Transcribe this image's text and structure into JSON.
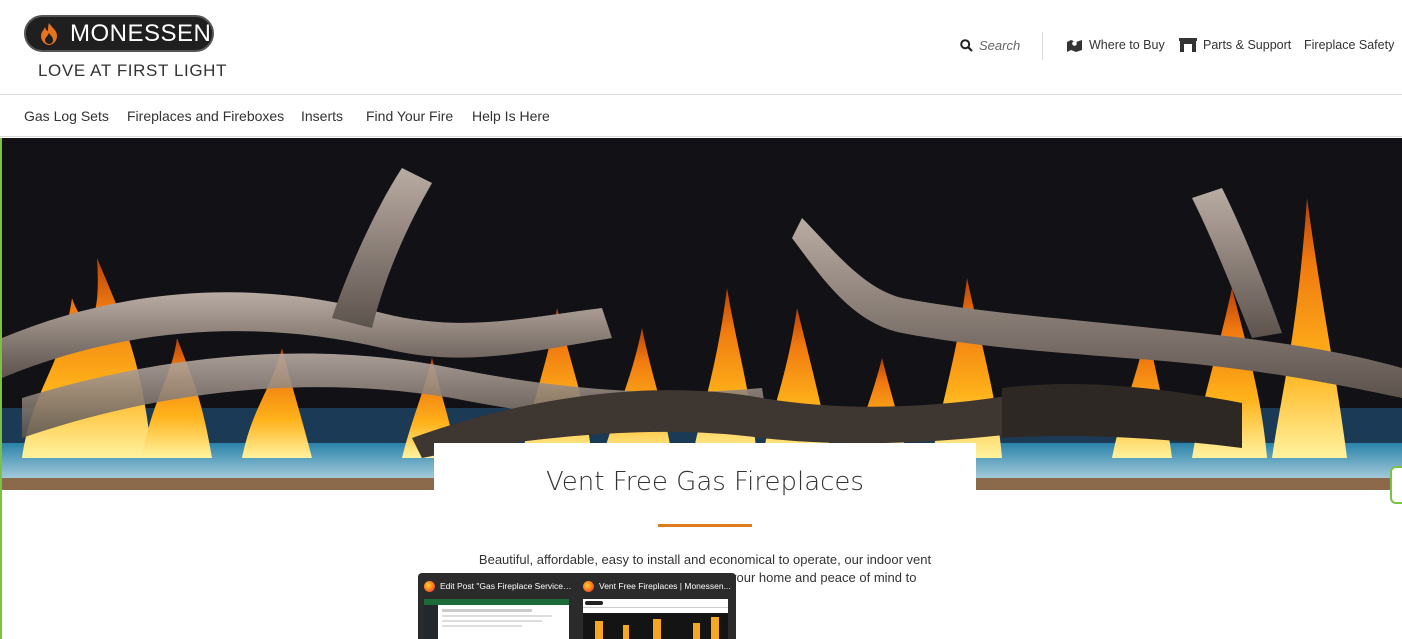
{
  "brand": {
    "name": "MONESSEN",
    "tagline": "LOVE AT FIRST LIGHT",
    "flame_color": "#e8731e"
  },
  "utility_nav": {
    "search_label": "Search",
    "where_to_buy": "Where to Buy",
    "parts_support": "Parts & Support",
    "fireplace_safety": "Fireplace Safety"
  },
  "main_nav": [
    {
      "label": "Gas Log Sets"
    },
    {
      "label": "Fireplaces and Fireboxes"
    },
    {
      "label": "Inserts"
    },
    {
      "label": "Find Your Fire"
    },
    {
      "label": "Help Is Here"
    }
  ],
  "hero": {
    "alt_icon": "fire-logs-image"
  },
  "content": {
    "title": "Vent Free Gas Fireplaces",
    "body_line1": "Beautiful, affordable, easy to install and economical to operate, our indoor vent",
    "body_line2": "your home and peace of mind to",
    "accent_color": "#e07a1f"
  },
  "taskbar_preview": {
    "windows": [
      {
        "title": "Edit Post \"Gas Fireplace Service ..."
      },
      {
        "title": "Vent Free Fireplaces | Monessen..."
      }
    ]
  }
}
